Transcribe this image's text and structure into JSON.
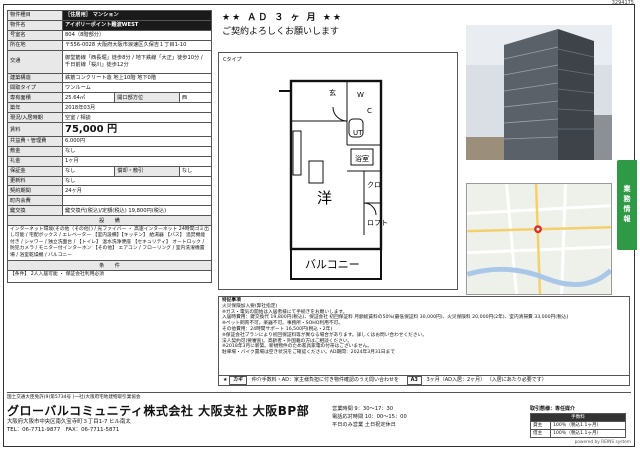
{
  "page_id": "3294175",
  "spec": {
    "rows": [
      {
        "k": "物件種目",
        "v": "［住居用］ マンション",
        "head": true
      },
      {
        "k": "物件名",
        "v": "アイボリーポイント難波WEST",
        "head": true
      },
      {
        "k": "号室名",
        "v": "804（8階部分）"
      },
      {
        "k": "所在地",
        "v": "〒556-0028 大阪府大阪市浪速区久保吉１丁目1-10"
      },
      {
        "k": "交通",
        "v": "御堂筋線「西長堀」徒歩8分 / 地下鉄線「大正」徒歩10分 / 千日前線「桜川」徒歩12分",
        "tall": true
      },
      {
        "k": "建築構造",
        "v": "鉄筋コンクリート造 地上10階 地下0階"
      },
      {
        "k": "間取タイプ",
        "v": "ワンルーム"
      },
      {
        "k": "専有面積",
        "v": "25.64㎡",
        "k2": "開口部方位",
        "v2": "西"
      },
      {
        "k": "築年",
        "v": "2018年03月"
      },
      {
        "k": "現況/入居時期",
        "v": "空室 / 相談"
      },
      {
        "k": "賃料",
        "v": "75,000 円",
        "price": true
      },
      {
        "k": "共益費・管理費",
        "v": "6,000円"
      },
      {
        "k": "敷金",
        "v": "なし"
      },
      {
        "k": "礼金",
        "v": "1ヶ月"
      },
      {
        "k": "保証金",
        "v": "なし",
        "k2": "償却・敷引",
        "v2": "なし"
      },
      {
        "k": "更新料",
        "v": "なし"
      },
      {
        "k": "契約期間",
        "v": "24ヶ月"
      },
      {
        "k": "町内会費",
        "v": ""
      },
      {
        "k": "鍵交換",
        "v": "鍵交換代(税込)/定額(税込) 19,800円(税込)"
      }
    ],
    "equipment_header": "設　　備",
    "equipment_body": "インターネット環境(その他（その他）) / 光ファイバー ・ 高速インターネット 24時間ゴミ出し可能 / 宅配ボックス / エレベーター 【室内設備】【キッチン】 給湯器 【バス】 追焚機能付き / シャワー / 独立洗面台 / 【トイレ】 温水洗浄便座 【セキュリティ】 オートロック / 防犯カメラ / モニター付インターホン 【その他】 エアコン / フローリング / 室内洗濯機置場 / 浴室乾燥機 / バルコニー",
    "conditions_header": "条　　件",
    "conditions_body": "【条件】 2人入居可能 ・ 保証会社利用必須"
  },
  "slogan": {
    "line1": "★★ ＡＤ ３ ヶ 月 ★★",
    "line2": "ご契約よろしくお願いします"
  },
  "floorplan": {
    "label": "Cタイプ",
    "rooms": [
      "洋",
      "バルコニー",
      "浴室",
      "UT",
      "クロ",
      "ロフト",
      "W",
      "C",
      "玄"
    ]
  },
  "remarks": {
    "title": "特記事項",
    "lines": [
      "火災保険加入要(弊社指定)",
      "※ガス・電気の開始は入居者様にて手続きをお願いします。",
      "入居時費用：鍵交換代 19,800円(税込)、保証会社 初回保証料 月額総賃料の50%(最低保証料 30,000円)、火災保険料 20,000円(2年)、室内清掃費 33,000円(税込)",
      "※ペット飼育不可。楽器不可。事務所・SOHO利用不可。",
      "その他費用：24時間サポート 16,500円(税込・2年)",
      "※保証会社プランにより初回保証料等が異なる場合があります。詳しくはお問い合わせください。",
      "法人契約可(要審査)。高齢者・外国籍の方はご相談ください。",
      "※2018年3月に新築。新規物件のため家具家電の付帯はございません。",
      "駐車場・バイク置場は空き状況をご確認ください。AD期間：2024年3月31日まで"
    ]
  },
  "ad": {
    "marker": "★",
    "label": "カギ",
    "text": "仲介手数料・AD：家主様負担に付き物件確認のうえ問い合わせを",
    "code": "A3",
    "period": "3ヶ月（AD入居：2ヶ月）",
    "note": "（入居にあたり必要です）"
  },
  "side_tab": "業務情報",
  "footer": {
    "license": "国土交通大臣免許(9)第5734号 (一社)大阪府宅地建物取引業協会",
    "company": "グローバルコミュニティ株式会社 大阪支社 大阪BP部",
    "address": "大阪府大阪市中央区南久宝寺町３丁目1-7 ヒル南太",
    "tel": "TEL：06-7711-9877",
    "fax": "FAX：06-7711-5871",
    "hours_label": "営業時間",
    "hours": "9：30～17：30",
    "phone_hours_label": "電話応対時間",
    "phone_hours": "10：00～15：00",
    "holiday_label": "平日のみ営業",
    "holiday": "土日祝定休日",
    "fee_title": "取引態様：専任媒介",
    "fee_header": "手数料",
    "fee_rows": [
      {
        "k": "貸主",
        "v": "100％（税込1.1ヶ月）"
      },
      {
        "k": "借主",
        "v": "100％（税込1.1ヶ月）"
      }
    ],
    "reins": "powered by REINS system"
  },
  "colors": {
    "accent_green": "#2e9a45",
    "header_dark": "#1a1a1a"
  }
}
